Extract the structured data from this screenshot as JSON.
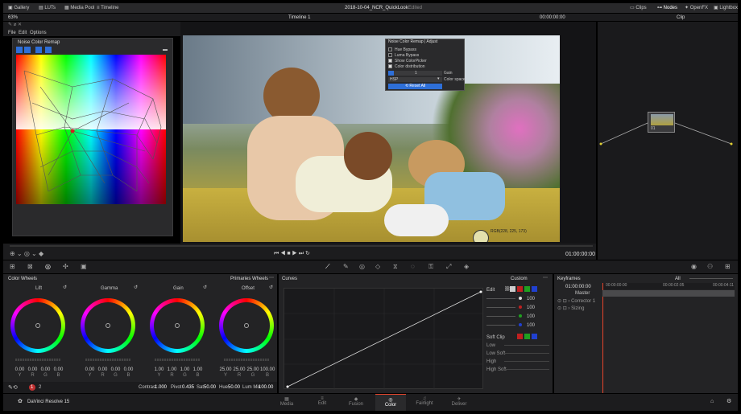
{
  "topbar": {
    "gallery": "Gallery",
    "luts": "LUTs",
    "media_pool": "Media Pool",
    "timeline": "Timeline",
    "title": "2018-10-04_NCR_QuickLook",
    "edited": "Edited",
    "clips": "Clips",
    "nodes": "Nodes",
    "openfx": "OpenFX",
    "lightbox": "Lightbox"
  },
  "viewer_bar": {
    "zoom": "63%",
    "timeline_name": "Timeline 1",
    "timecode": "00:00:00:00",
    "clip": "Clip"
  },
  "menu": {
    "file": "File",
    "edit": "Edit",
    "options": "Options"
  },
  "plugin_panel": {
    "title": "Noise Color Remap"
  },
  "overlay": {
    "title": "Noise Color Remap | Adjust",
    "hue_bypass": "Hue Bypass",
    "luma_bypass": "Luma Bypass",
    "show_picker": "Show ColorPicker",
    "color_dist": "Color distribution",
    "gain_value": "1",
    "gain_label": "Gain",
    "space_value": "HSP",
    "space_label": "Color space",
    "reset": "Reset All"
  },
  "viewer": {
    "rgb_readout": "RGB(228, 225, 173)",
    "timecode": "01:00:00:00"
  },
  "node": {
    "label": "01"
  },
  "color_wheels": {
    "title": "Color Wheels",
    "mode": "Primaries Wheels",
    "wheels": [
      {
        "name": "Lift",
        "v": [
          "0.00",
          "0.00",
          "0.00",
          "0.00"
        ]
      },
      {
        "name": "Gamma",
        "v": [
          "0.00",
          "0.00",
          "0.00",
          "0.00"
        ]
      },
      {
        "name": "Gain",
        "v": [
          "1.00",
          "1.00",
          "1.00",
          "1.00"
        ]
      },
      {
        "name": "Offset",
        "v": [
          "25.00",
          "25.00",
          "25.00",
          "100.00"
        ]
      }
    ],
    "ch": [
      "Y",
      "R",
      "G",
      "B"
    ],
    "bottom": {
      "contrast_l": "Contrast",
      "contrast": "1.000",
      "pivot_l": "Pivot",
      "pivot": "0.435",
      "sat_l": "Sat",
      "sat": "50.00",
      "hue_l": "Hue",
      "hue": "50.00",
      "lummix_l": "Lum Mix",
      "lummix": "100.00"
    },
    "page1": "1",
    "page2": "2"
  },
  "curves": {
    "title": "Curves",
    "mode": "Custom",
    "edit": "Edit",
    "intensity": [
      "100",
      "100",
      "100",
      "100"
    ],
    "soft_clip": "Soft Clip",
    "low": "Low",
    "low_soft": "Low Soft",
    "high": "High",
    "high_soft": "High Soft"
  },
  "keyframes": {
    "title": "Keyframes",
    "all": "All",
    "tc1": "01:00:00:00",
    "tc2": "00:00:00:00",
    "tc3": "00:00:02:05",
    "tc4": "00:00:04:11",
    "master": "Master",
    "corrector": "Corrector 1",
    "sizing": "Sizing"
  },
  "pages": {
    "app": "DaVinci Resolve 15",
    "media": "Media",
    "edit": "Edit",
    "fusion": "Fusion",
    "color": "Color",
    "fairlight": "Fairlight",
    "deliver": "Deliver"
  },
  "colors": {
    "accent": "#e8452c",
    "panel": "#1f1f21",
    "viewer_bg": "#141416"
  }
}
